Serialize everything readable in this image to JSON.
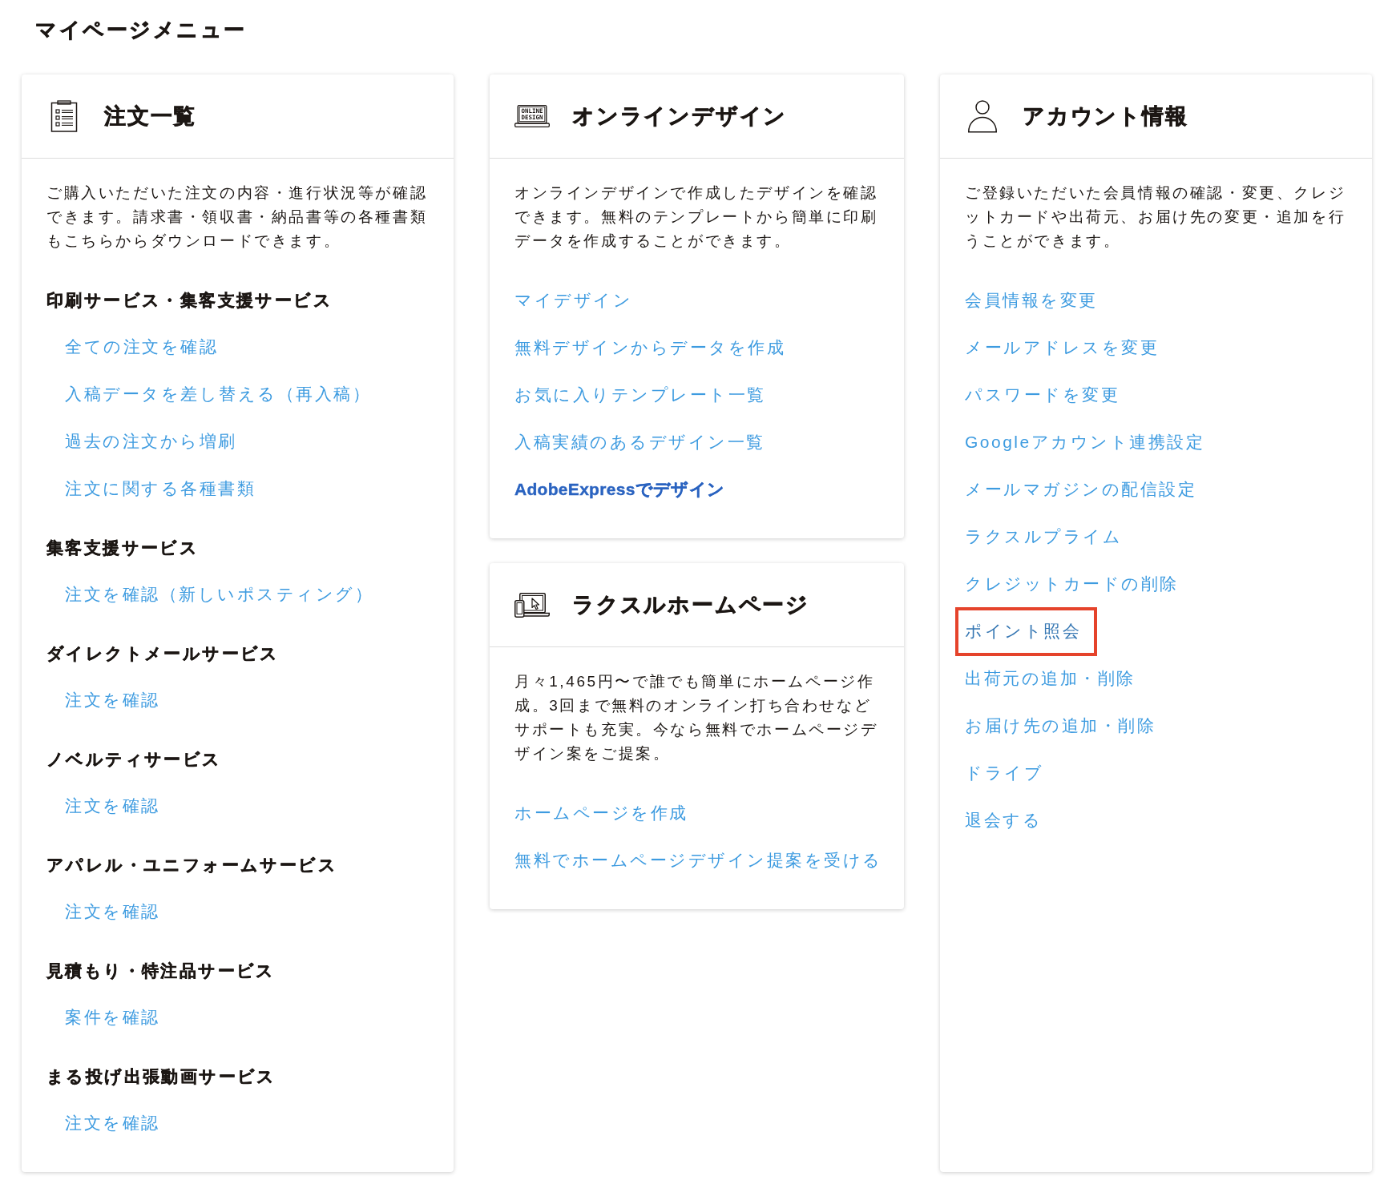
{
  "page_title": "マイページメニュー",
  "columns": [
    {
      "cards": [
        {
          "title": "注文一覧",
          "description": "ご購入いただいた注文の内容・進行状況等が確認できます。請求書・領収書・納品書等の各種書類もこちらからダウンロードできます。",
          "sections": [
            {
              "heading": "印刷サービス・集客支援サービス",
              "links": [
                {
                  "label": "全ての注文を確認"
                },
                {
                  "label": "入稿データを差し替える（再入稿）"
                },
                {
                  "label": "過去の注文から増刷"
                },
                {
                  "label": "注文に関する各種書類"
                }
              ]
            },
            {
              "heading": "集客支援サービス",
              "links": [
                {
                  "label": "注文を確認（新しいポスティング）"
                }
              ]
            },
            {
              "heading": "ダイレクトメールサービス",
              "links": [
                {
                  "label": "注文を確認"
                }
              ]
            },
            {
              "heading": "ノベルティサービス",
              "links": [
                {
                  "label": "注文を確認"
                }
              ]
            },
            {
              "heading": "アパレル・ユニフォームサービス",
              "links": [
                {
                  "label": "注文を確認"
                }
              ]
            },
            {
              "heading": "見積もり・特注品サービス",
              "links": [
                {
                  "label": "案件を確認"
                }
              ]
            },
            {
              "heading": "まる投げ出張動画サービス",
              "links": [
                {
                  "label": "注文を確認"
                }
              ]
            }
          ]
        }
      ]
    },
    {
      "cards": [
        {
          "icon_text": [
            "ONLINE",
            "DESIGN"
          ],
          "title": "オンラインデザイン",
          "description": "オンラインデザインで作成したデザインを確認できます。無料のテンプレートから簡単に印刷データを作成することができます。",
          "sections": [
            {
              "links": [
                {
                  "label": "マイデザイン",
                  "kind": "plain"
                },
                {
                  "label": "無料デザインからデータを作成",
                  "kind": "plain"
                },
                {
                  "label": "お気に入りテンプレート一覧",
                  "kind": "plain"
                },
                {
                  "label": "入稿実績のあるデザイン一覧",
                  "kind": "plain"
                },
                {
                  "label": "AdobeExpressでデザイン",
                  "kind": "featured"
                }
              ]
            }
          ]
        },
        {
          "title": "ラクスルホームページ",
          "description": "月々1,465円〜で誰でも簡単にホームページ作成。3回まで無料のオンライン打ち合わせなどサポートも充実。今なら無料でホームページデザイン案をご提案。",
          "sections": [
            {
              "links": [
                {
                  "label": "ホームページを作成"
                },
                {
                  "label": "無料でホームページデザイン提案を受ける"
                }
              ]
            }
          ]
        }
      ]
    },
    {
      "cards": [
        {
          "title": "アカウント情報",
          "description": "ご登録いただいた会員情報の確認・変更、クレジットカードや出荷元、お届け先の変更・追加を行うことができます。",
          "sections": [
            {
              "links": [
                {
                  "label": "会員情報を変更",
                  "highlighted": false
                },
                {
                  "label": "メールアドレスを変更",
                  "highlighted": false
                },
                {
                  "label": "パスワードを変更",
                  "highlighted": false
                },
                {
                  "label": "Googleアカウント連携設定",
                  "highlighted": false
                },
                {
                  "label": "メールマガジンの配信設定",
                  "highlighted": false
                },
                {
                  "label": "ラクスルプライム",
                  "highlighted": false
                },
                {
                  "label": "クレジットカードの削除",
                  "highlighted": false
                },
                {
                  "label": "ポイント照会",
                  "highlighted": true
                },
                {
                  "label": "出荷元の追加・削除",
                  "highlighted": false
                },
                {
                  "label": "お届け先の追加・削除",
                  "highlighted": false
                },
                {
                  "label": "ドライブ",
                  "highlighted": false
                },
                {
                  "label": "退会する",
                  "highlighted": false
                }
              ]
            }
          ]
        }
      ]
    }
  ]
}
